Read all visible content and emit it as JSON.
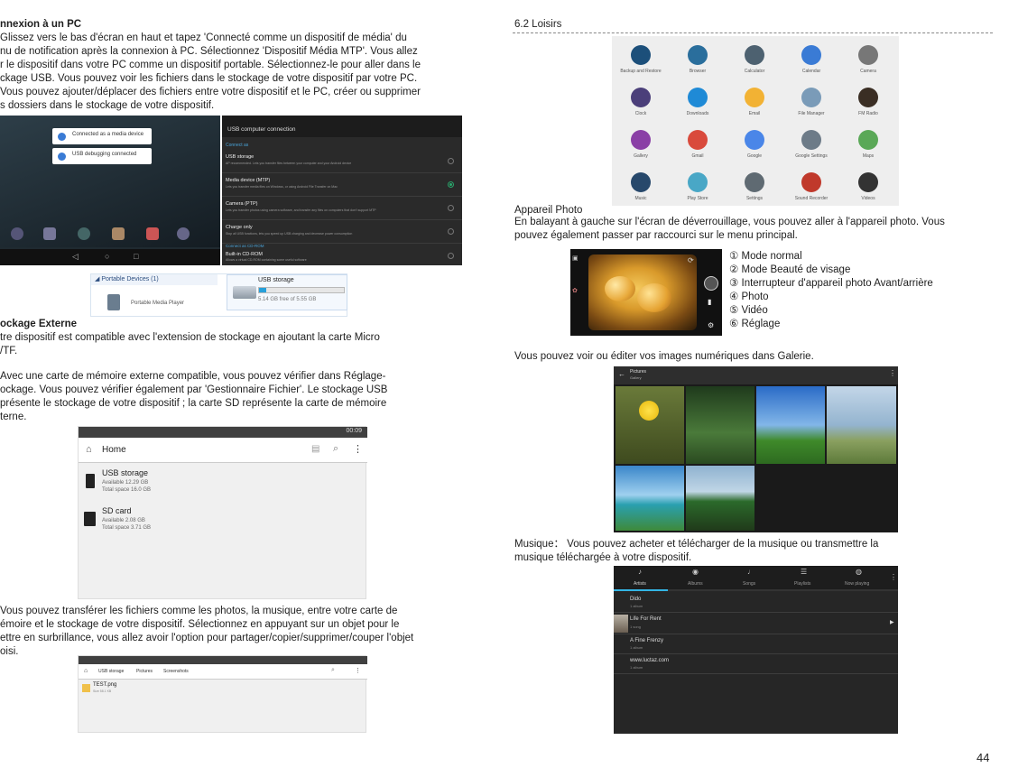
{
  "left": {
    "sec1_title": "nnexion à un PC",
    "sec1_lines": [
      "Glissez vers le bas d'écran en haut et tapez 'Connecté comme un dispositif de média' du",
      "nu de notification après la connexion à PC. Sélectionnez 'Dispositif Média MTP'. Vous allez",
      "r le dispositif dans votre PC comme un dispositif portable. Sélectionnez-le pour aller dans le",
      "ckage USB. Vous pouvez voir les fichiers dans le stockage de votre dispositif par votre PC.",
      "Vous pouvez ajouter/déplacer des fichiers entre votre dispositif et le PC, créer ou supprimer",
      "s dossiers dans le stockage de votre dispositif."
    ],
    "usb_screen": {
      "title": "USB computer connection",
      "notif1": "Connected as a media device",
      "notif2": "USB debugging connected",
      "section_label": "Connect as",
      "options": [
        {
          "title": "USB storage",
          "desc": "AP recommended. Lets you transfer files between your computer and your Android device",
          "on": false
        },
        {
          "title": "Media device (MTP)",
          "desc": "Lets you transfer media files on Windows, or using Android File Transfer on Mac",
          "on": true
        },
        {
          "title": "Camera (PTP)",
          "desc": "Lets you transfer photos using camera software, and transfer any files on computers that don't support MTP",
          "on": false
        },
        {
          "title": "Charge only",
          "desc": "Stop all USB functions, lets you speed up USB charging and decrease power consumption",
          "on": false
        }
      ],
      "cdrom_label": "Connect as CD-ROM",
      "cdrom_title": "Built-in CD-ROM",
      "cdrom_desc": "Allows a virtual CD-ROM containing some useful software"
    },
    "explorer": {
      "portable_label": "Portable Devices (1)",
      "device_name": "Portable Media Player",
      "storage_title": "USB storage",
      "storage_free": "5.14 GB free of 5.55 GB",
      "fill_fraction": 0.08
    },
    "sec2_title": "ockage Externe",
    "sec2_lines": [
      "tre dispositif est compatible avec l'extension de stockage en ajoutant la carte Micro",
      "/TF."
    ],
    "sec3_lines": [
      "Avec une carte de mémoire externe compatible, vous pouvez vérifier dans Réglage-",
      "ockage. Vous pouvez vérifier également par 'Gestionnaire Fichier'. Le stockage USB",
      "présente le stockage de votre dispositif ; la carte SD représente la carte de mémoire",
      "terne."
    ],
    "filemgr": {
      "status_time": "00:09",
      "home": "Home",
      "items": [
        {
          "name": "USB storage",
          "avail": "Available 12.29 GB",
          "total": "Total space 16.0 GB"
        },
        {
          "name": "SD card",
          "avail": "Available 2.08 GB",
          "total": "Total space 3.71 GB"
        }
      ]
    },
    "sec4_lines": [
      "Vous pouvez transférer les fichiers comme les photos, la musique, entre votre carte de",
      "émoire et le stockage de votre dispositif. Sélectionnez en appuyant sur un objet pour le",
      "ettre en surbrillance, vous allez avoir l'option pour partager/copier/supprimer/couper l'objet",
      "oisi."
    ],
    "filemgr2": {
      "crumbs": [
        "USB storage",
        "Pictures",
        "Screenshots"
      ],
      "file": "TEST.png",
      "file_meta": "Size 58.1 KB"
    }
  },
  "right": {
    "section_title": "6.2 Loisirs",
    "apps": [
      {
        "label": "Backup and Restore",
        "color": "#1c4f7a",
        "icon": "backup-icon"
      },
      {
        "label": "Browser",
        "color": "#2a6e9c",
        "icon": "globe-icon"
      },
      {
        "label": "Calculator",
        "color": "#4d6170",
        "icon": "calculator-icon"
      },
      {
        "label": "Calendar",
        "color": "#3a7bd5",
        "icon": "calendar-icon"
      },
      {
        "label": "Camera",
        "color": "#777777",
        "icon": "camera-icon"
      },
      {
        "label": "Clock",
        "color": "#4b3f7a",
        "icon": "clock-icon"
      },
      {
        "label": "Downloads",
        "color": "#1f8ad6",
        "icon": "download-icon"
      },
      {
        "label": "Email",
        "color": "#f2b234",
        "icon": "email-icon"
      },
      {
        "label": "File Manager",
        "color": "#7a9bb8",
        "icon": "folder-icon"
      },
      {
        "label": "FM Radio",
        "color": "#3a2e24",
        "icon": "radio-icon"
      },
      {
        "label": "Gallery",
        "color": "#8a3fa6",
        "icon": "gallery-icon"
      },
      {
        "label": "Gmail",
        "color": "#d94a3c",
        "icon": "gmail-icon"
      },
      {
        "label": "Google",
        "color": "#4a86e8",
        "icon": "google-icon"
      },
      {
        "label": "Google Settings",
        "color": "#6d7b88",
        "icon": "google-settings-icon"
      },
      {
        "label": "Maps",
        "color": "#5aa857",
        "icon": "maps-icon"
      },
      {
        "label": "Music",
        "color": "#27486b",
        "icon": "music-icon"
      },
      {
        "label": "Play Store",
        "color": "#49a7c6",
        "icon": "play-store-icon"
      },
      {
        "label": "Settings",
        "color": "#5f6a72",
        "icon": "settings-icon"
      },
      {
        "label": "Sound Recorder",
        "color": "#c0392b",
        "icon": "microphone-icon"
      },
      {
        "label": "Videos",
        "color": "#333333",
        "icon": "clapper-icon"
      }
    ],
    "apn_title": "Appareil Photo",
    "apn_lines": [
      "En balayant à gauche sur l'écran de déverrouillage, vous pouvez aller à l'appareil photo. Vous",
      "pouvez également passer par raccourci sur le menu principal."
    ],
    "camera_features": [
      "① Mode normal",
      "② Mode Beauté de visage",
      "③ Interrupteur d'appareil photo Avant/arrière",
      "④ Photo",
      "⑤ Vidéo",
      "⑥ Réglage"
    ],
    "galerie_line": "Vous pouvez voir ou éditer vos images numériques dans Galerie.",
    "gallery_header": "Pictures",
    "gallery_sub": "Gallery",
    "music_lines": [
      "Musique： Vous pouvez acheter et télécharger de la musique ou transmettre la",
      "musique téléchargée à votre dispositif."
    ],
    "music_tabs": [
      "Artists",
      "Albums",
      "Songs",
      "Playlists",
      "Now playing"
    ],
    "music_rows": [
      {
        "title": "Dido",
        "sub": "1 album"
      },
      {
        "title": "Life For Rent",
        "sub": "1 song"
      },
      {
        "title": "A Fine Frenzy",
        "sub": "1 album"
      },
      {
        "title": "www.luctaz.com",
        "sub": "1 album"
      }
    ],
    "page_number": "44"
  }
}
